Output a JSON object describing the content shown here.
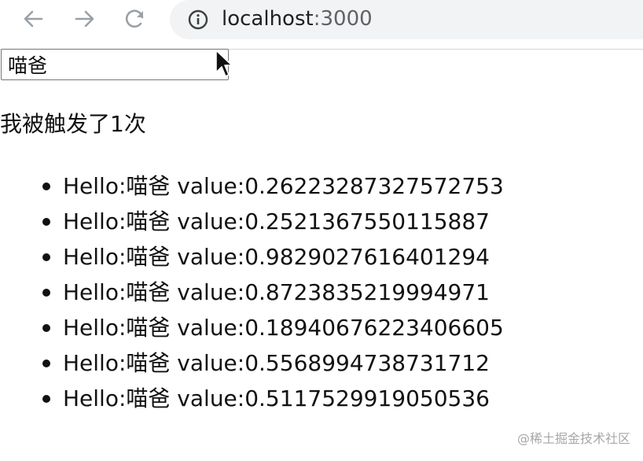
{
  "browser": {
    "url_host": "localhost",
    "url_port": ":3000",
    "back_icon": "arrow-left-icon",
    "forward_icon": "arrow-right-icon",
    "reload_icon": "reload-icon",
    "info_icon": "info-icon"
  },
  "page": {
    "input_value": "喵爸",
    "count_text": "我被触发了1次",
    "items": [
      {
        "label": "Hello:喵爸 value:0.26223287327572753"
      },
      {
        "label": "Hello:喵爸 value:0.2521367550115887"
      },
      {
        "label": "Hello:喵爸 value:0.9829027616401294"
      },
      {
        "label": "Hello:喵爸 value:0.8723835219994971"
      },
      {
        "label": "Hello:喵爸 value:0.18940676223406605"
      },
      {
        "label": "Hello:喵爸 value:0.5568994738731712"
      },
      {
        "label": "Hello:喵爸 value:0.5117529919050536"
      }
    ]
  },
  "watermark": "@稀土掘金技术社区",
  "colors": {
    "omnibox_bg": "#f1f3f4",
    "nav_icon_gray": "#9aa0a6",
    "port_gray": "#5f6368",
    "watermark_gray": "#a7a7a7"
  }
}
